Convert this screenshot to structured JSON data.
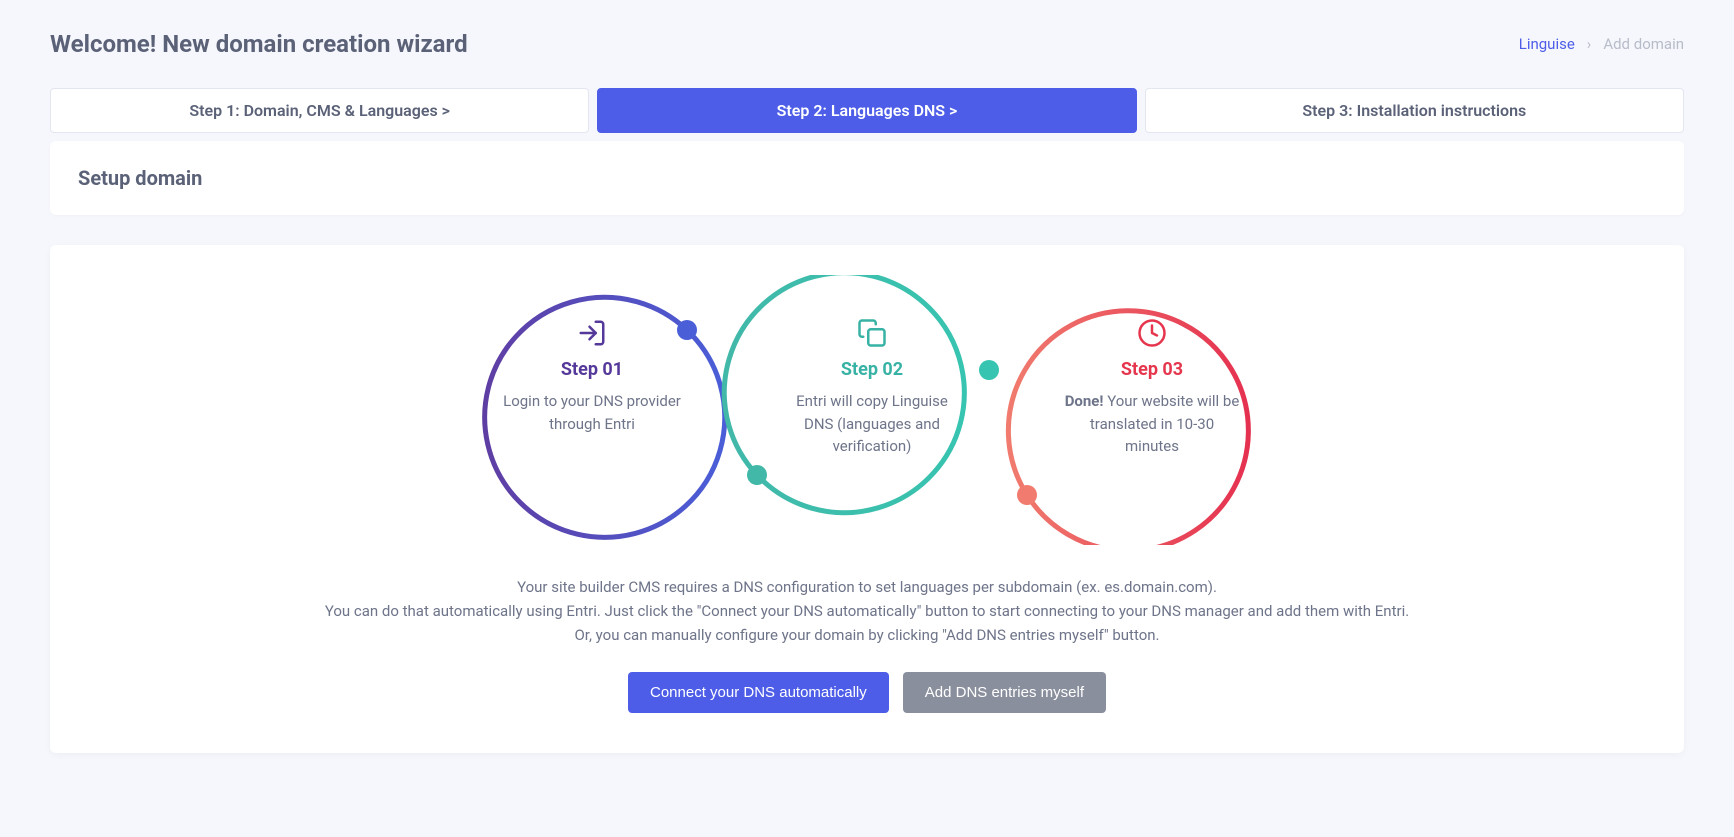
{
  "header": {
    "title": "Welcome! New domain creation wizard",
    "breadcrumb": {
      "root": "Linguise",
      "current": "Add domain"
    }
  },
  "tabs": [
    {
      "label": "Step 1: Domain, CMS & Languages  >"
    },
    {
      "label": "Step 2: Languages DNS  >"
    },
    {
      "label": "Step 3: Installation instructions"
    }
  ],
  "panel": {
    "title": "Setup domain"
  },
  "steps": [
    {
      "title": "Step 01",
      "desc": "Login to your DNS provider through Entri"
    },
    {
      "title": "Step 02",
      "desc": "Entri will copy Linguise DNS (languages and verification)"
    },
    {
      "title": "Step 03",
      "desc_prefix": "Done!",
      "desc_rest": " Your website will be translated in 10-30 minutes"
    }
  ],
  "info": {
    "line1": "Your site builder CMS requires a DNS configuration to set languages per subdomain (ex. es.domain.com).",
    "line2": "You can do that automatically using Entri. Just click the \"Connect your DNS automatically\" button to start connecting to your DNS manager and add them with Entri.",
    "line3": "Or, you can manually configure your domain by clicking \"Add DNS entries myself\" button."
  },
  "buttons": {
    "primary": "Connect your DNS automatically",
    "secondary": "Add DNS entries myself"
  }
}
